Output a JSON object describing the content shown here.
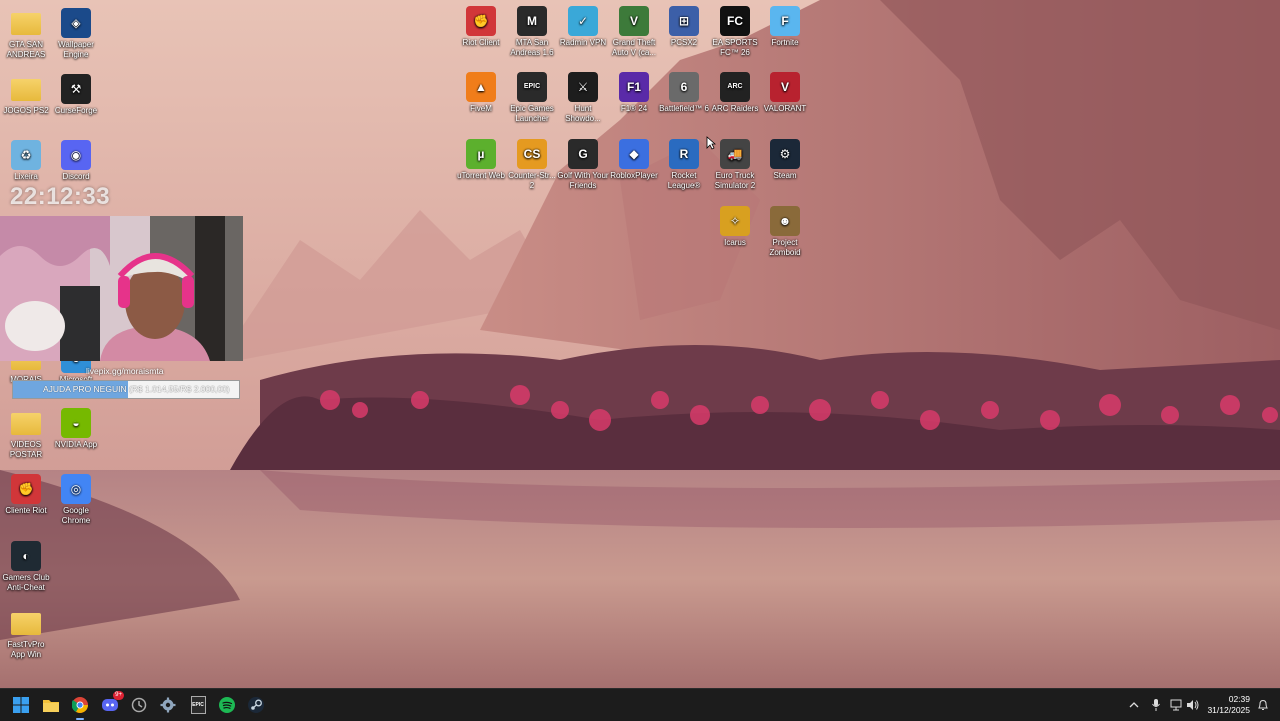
{
  "overlay": {
    "clock": "22:12:33",
    "livepix_url": "livepix.gg/moraismta",
    "donation_text": "AJUDA PRO NEGUIN (R$ 1.014,55/R$ 2.000,00)",
    "donation_progress": 0.507
  },
  "desktop_left": [
    {
      "label": "GTA SAN ANDREAS",
      "icon": "folder-icon",
      "color": "#e7b93c"
    },
    {
      "label": "Wallpaper Engine",
      "icon": "wallpaper-engine-icon",
      "color": "#1b4a8a"
    },
    {
      "label": "JOGOS PS2",
      "icon": "folder-icon",
      "color": "#e7b93c"
    },
    {
      "label": "CurseForge",
      "icon": "curseforge-icon",
      "color": "#222222"
    },
    {
      "label": "Lixeira",
      "icon": "recycle-bin-icon",
      "color": "#6fb3e0"
    },
    {
      "label": "Discord",
      "icon": "discord-icon",
      "color": "#5865f2"
    },
    {
      "label": "MORAIS",
      "icon": "folder-icon",
      "color": "#e7b93c"
    },
    {
      "label": "Microsoft",
      "icon": "edge-icon",
      "color": "#2f8fd8"
    },
    {
      "label": "VIDEOS POSTAR",
      "icon": "folder-icon",
      "color": "#e7b93c"
    },
    {
      "label": "NVIDIA App",
      "icon": "nvidia-icon",
      "color": "#76b900"
    },
    {
      "label": "Cliente Riot",
      "icon": "riot-icon",
      "color": "#d13639"
    },
    {
      "label": "Google Chrome",
      "icon": "chrome-icon",
      "color": "#4285f4"
    },
    {
      "label": "Gamers Club Anti-Cheat",
      "icon": "gamers-club-icon",
      "color": "#1f2a33"
    },
    {
      "label": "FastTvPro App Win",
      "icon": "folder-icon",
      "color": "#e7b93c"
    }
  ],
  "desktop_right": [
    {
      "label": "Riot Client",
      "icon": "riot-icon",
      "color": "#d13639"
    },
    {
      "label": "MTA San Andreas 1.6",
      "icon": "mta-icon",
      "color": "#2a2a2a"
    },
    {
      "label": "Radmin VPN",
      "icon": "radmin-icon",
      "color": "#3aa8d8"
    },
    {
      "label": "Grand Theft Auto V (ca...",
      "icon": "gta-v-icon",
      "color": "#3d7a3a"
    },
    {
      "label": "PCSX2",
      "icon": "pcsx2-icon",
      "color": "#3c5fa8"
    },
    {
      "label": "EA SPORTS FC™ 26",
      "icon": "ea-fc-icon",
      "color": "#111111"
    },
    {
      "label": "Fortnite",
      "icon": "fortnite-icon",
      "color": "#5ab6ef"
    },
    {
      "label": "FiveM",
      "icon": "fivem-icon",
      "color": "#f07d1a"
    },
    {
      "label": "Epic Games Launcher",
      "icon": "epic-games-icon",
      "color": "#2a2a2a"
    },
    {
      "label": "Hunt Showdo...",
      "icon": "hunt-icon",
      "color": "#1d1d1d"
    },
    {
      "label": "F1® 24",
      "icon": "f1-icon",
      "color": "#5a2aa8"
    },
    {
      "label": "Battlefield™ 6",
      "icon": "battlefield-icon",
      "color": "#6a6a6a"
    },
    {
      "label": "ARC Raiders",
      "icon": "arc-raiders-icon",
      "color": "#222222"
    },
    {
      "label": "VALORANT",
      "icon": "valorant-icon",
      "color": "#b8222f"
    },
    {
      "label": "uTorrent Web",
      "icon": "utorrent-icon",
      "color": "#5cb02d"
    },
    {
      "label": "Counter-Str... 2",
      "icon": "cs2-icon",
      "color": "#e59a20"
    },
    {
      "label": "Golf With Your Friends",
      "icon": "golf-icon",
      "color": "#2a2a2a"
    },
    {
      "label": "RobloxPlayer",
      "icon": "roblox-icon",
      "color": "#3b6fe0"
    },
    {
      "label": "Rocket League®",
      "icon": "rocket-league-icon",
      "color": "#2a6bc0"
    },
    {
      "label": "Euro Truck Simulator 2",
      "icon": "ets2-icon",
      "color": "#444444"
    },
    {
      "label": "Steam",
      "icon": "steam-icon",
      "color": "#1b2838"
    },
    {
      "label": "Icarus",
      "icon": "icarus-icon",
      "color": "#d8a020"
    },
    {
      "label": "Project Zomboid",
      "icon": "zomboid-icon",
      "color": "#8a6a3a"
    }
  ],
  "taskbar": {
    "start": "windows-start-icon",
    "apps": [
      {
        "name": "file-explorer-icon"
      },
      {
        "name": "chrome-icon"
      },
      {
        "name": "discord-icon",
        "badge": "9+"
      },
      {
        "name": "clock-app-icon"
      },
      {
        "name": "settings-icon"
      },
      {
        "name": "epic-games-icon",
        "text": "EPIC"
      },
      {
        "name": "spotify-icon"
      },
      {
        "name": "steam-icon"
      }
    ],
    "time": "02:39",
    "date": "31/12/2025"
  }
}
